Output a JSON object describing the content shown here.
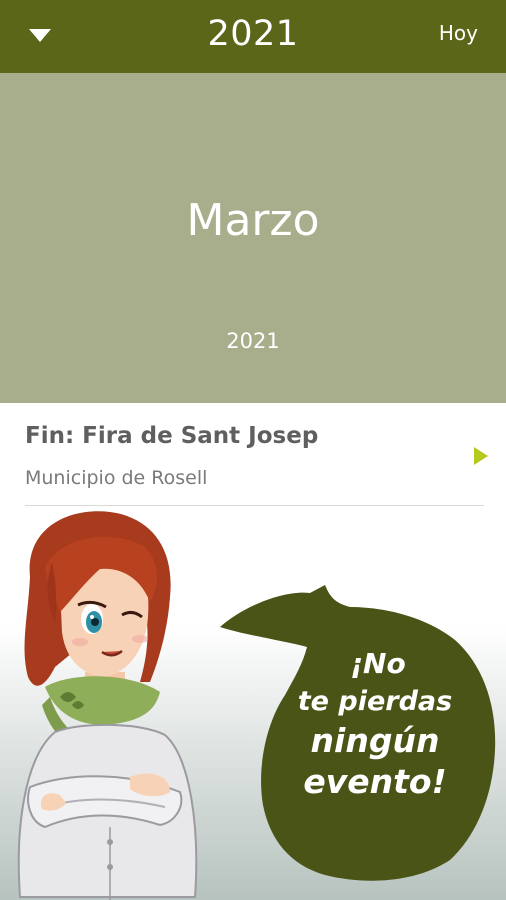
{
  "topbar": {
    "year": "2021",
    "today_label": "Hoy",
    "background": "#5c6619"
  },
  "month_banner": {
    "month": "Marzo",
    "year": "2021",
    "background": "#a8ae8b"
  },
  "events": [
    {
      "title": "Fin: Fira de Sant Josep",
      "location": "Municipio de Rosell",
      "arrow_color": "#b5c920"
    }
  ],
  "promo": {
    "bubble_lines": [
      "¡No",
      "te pierdas",
      "ningún",
      "evento!"
    ],
    "bubble_color": "#4a5417"
  },
  "icons": {
    "dropdown": "caret-down-icon",
    "event_arrow": "play-arrow-icon"
  }
}
